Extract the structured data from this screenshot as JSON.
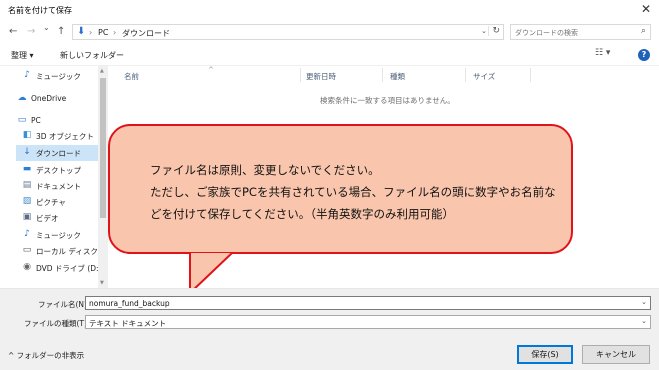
{
  "window": {
    "title": "名前を付けて保存",
    "close_glyph": "✕"
  },
  "nav": {
    "back_glyph": "←",
    "forward_glyph": "→",
    "recent_glyph": "⌄",
    "up_glyph": "↑",
    "path_sep": "›",
    "path": [
      "PC",
      "ダウンロード"
    ],
    "dropdown_glyph": "⌄",
    "refresh_glyph": "↻",
    "search_placeholder": "ダウンロードの検索",
    "search_icon": "search-icon"
  },
  "toolbar": {
    "organize_label": "整理 ▾",
    "new_folder_label": "新しいフォルダー",
    "view_glyph": "☷ ▾",
    "help_glyph": "?"
  },
  "sidebar": {
    "items": [
      {
        "label": "ミュージック",
        "icon": "music-icon",
        "glyph": "♪",
        "color": "#2d6ecb"
      },
      {
        "label": "OneDrive",
        "icon": "cloud-icon",
        "glyph": "☁",
        "color": "#2d7fd8"
      },
      {
        "label": "PC",
        "icon": "pc-icon",
        "glyph": "▭",
        "color": "#2a6fd1"
      },
      {
        "label": "3D オブジェクト",
        "icon": "cube-icon",
        "glyph": "◧",
        "color": "#3b8fd6"
      },
      {
        "label": "ダウンロード",
        "icon": "download-icon",
        "glyph": "↓",
        "color": "#2a6fd1"
      },
      {
        "label": "デスクトップ",
        "icon": "desktop-icon",
        "glyph": "▬",
        "color": "#2a80d6"
      },
      {
        "label": "ドキュメント",
        "icon": "document-icon",
        "glyph": "▤",
        "color": "#6b7c93"
      },
      {
        "label": "ピクチャ",
        "icon": "picture-icon",
        "glyph": "▨",
        "color": "#4a8fc9"
      },
      {
        "label": "ビデオ",
        "icon": "video-icon",
        "glyph": "▣",
        "color": "#5a6c85"
      },
      {
        "label": "ミュージック",
        "icon": "music-icon",
        "glyph": "♪",
        "color": "#2d6ecb"
      },
      {
        "label": "ローカル ディスク (C",
        "icon": "drive-icon",
        "glyph": "▭",
        "color": "#555555"
      },
      {
        "label": "DVD ドライブ (D:)",
        "icon": "dvd-icon",
        "glyph": "◉",
        "color": "#666666"
      }
    ],
    "selected_index": 4
  },
  "filelist": {
    "columns": [
      "名前",
      "更新日時",
      "種類",
      "サイズ"
    ],
    "sort_glyph": "^",
    "empty_message": "検索条件に一致する項目はありません。"
  },
  "callout": {
    "lines": [
      "ファイル名は原則、変更しないでください。",
      "ただし、ご家族でPCを共有されている場合、ファイル名の頭に数字やお名前な",
      "どを付けて保存してください。（半角英数字のみ利用可能）"
    ],
    "fill_color": "#f9c6ad",
    "border_color": "#e0131a"
  },
  "save_form": {
    "filename_label": "ファイル名(N):",
    "filename_value": "nomura_fund_backup",
    "filetype_label": "ファイルの種類(T):",
    "filetype_value": "テキスト ドキュメント",
    "chevron_glyph": "⌄",
    "hide_folders_label": "^ フォルダーの非表示",
    "save_label": "保存(S)",
    "cancel_label": "キャンセル"
  }
}
